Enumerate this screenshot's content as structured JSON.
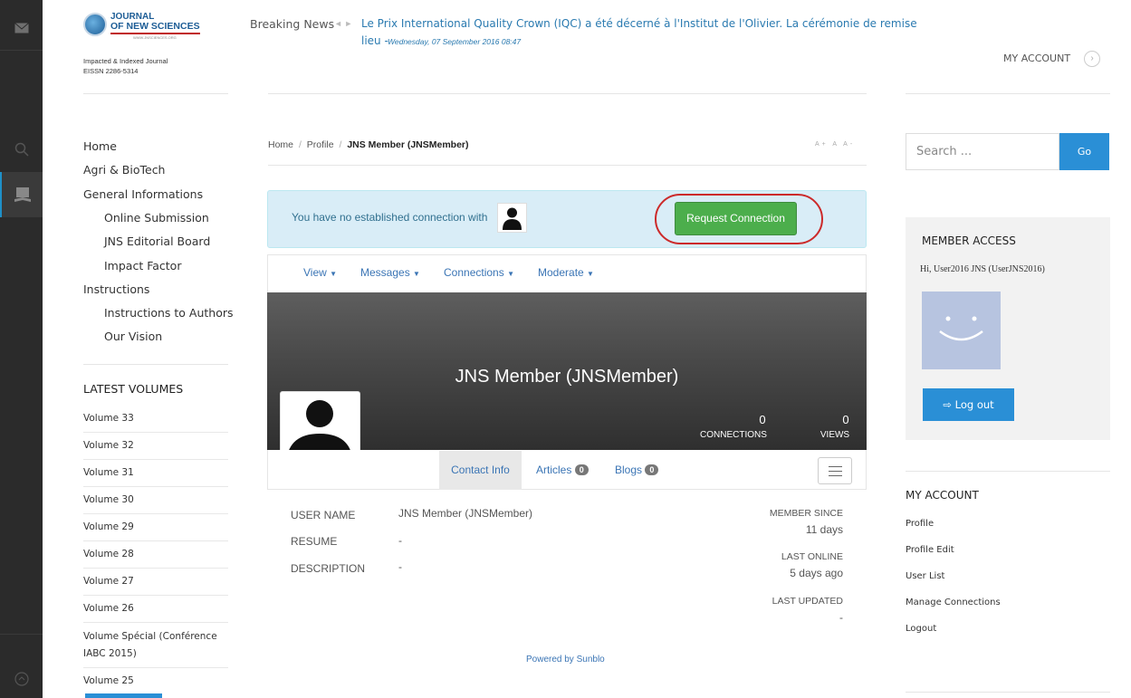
{
  "rail": {
    "icons": [
      "mail-icon",
      "search-icon",
      "book-reader-icon",
      "arrow-circle-icon"
    ]
  },
  "logo": {
    "line1": "JOURNAL",
    "line2": "OF NEW SCIENCES",
    "line3": "WWW.JNSCIENCES.ORG",
    "sub1": "Impacted & Indexed Journal",
    "sub2": "EISSN 2286-5314"
  },
  "news": {
    "label": "Breaking News",
    "text": "Le Prix International Quality Crown (IQC) a été décerné à l'Institut de l'Olivier. La cérémonie de remise",
    "text2": "lieu -",
    "date": "Wednesday, 07 September 2016 08:47"
  },
  "header": {
    "my_account": "MY ACCOUNT"
  },
  "menu": {
    "items": [
      {
        "label": "Home"
      },
      {
        "label": "Agri & BioTech"
      },
      {
        "label": "General Informations"
      },
      {
        "label": "Online Submission"
      },
      {
        "label": "JNS Editorial Board"
      },
      {
        "label": "Impact Factor"
      },
      {
        "label": "Instructions"
      },
      {
        "label": "Instructions to Authors"
      },
      {
        "label": "Our Vision"
      }
    ]
  },
  "latest": {
    "title": "LATEST VOLUMES",
    "volumes": [
      "Volume 33",
      "Volume 32",
      "Volume 31",
      "Volume 30",
      "Volume 29",
      "Volume 28",
      "Volume 27",
      "Volume 26",
      "Volume Spécial (Conférence",
      "IABC 2015)",
      "Volume 25"
    ]
  },
  "breadcrumb": {
    "home": "Home",
    "sep": "/",
    "profile": "Profile",
    "current": "JNS Member (JNSMember)",
    "font_controls": "A+ A A-"
  },
  "alert": {
    "text": "You have no established connection with",
    "button": "Request Connection"
  },
  "profile_nav": {
    "items": [
      "View",
      "Messages",
      "Connections",
      "Moderate"
    ]
  },
  "cover": {
    "name": "JNS Member (JNSMember)",
    "connections_count": "0",
    "connections_label": "CONNECTIONS",
    "views_count": "0",
    "views_label": "VIEWS"
  },
  "tabs": {
    "contact": "Contact Info",
    "articles": "Articles",
    "articles_count": "0",
    "blogs": "Blogs",
    "blogs_count": "0"
  },
  "info": {
    "username_label": "USER NAME",
    "username_value": "JNS Member (JNSMember)",
    "resume_label": "RESUME",
    "resume_value": "-",
    "description_label": "DESCRIPTION",
    "description_value": "-",
    "member_since_label": "MEMBER SINCE",
    "member_since_value": "11 days",
    "last_online_label": "LAST ONLINE",
    "last_online_value": "5 days ago",
    "last_updated_label": "LAST UPDATED",
    "last_updated_value": "-"
  },
  "footer": {
    "powered": "Powered by Sunblo"
  },
  "search": {
    "placeholder": "Search ...",
    "button": "Go"
  },
  "member_access": {
    "title": "MEMBER ACCESS",
    "greeting": "Hi, User2016 JNS (UserJNS2016)",
    "logout": "Log out"
  },
  "my_account": {
    "title": "MY ACCOUNT",
    "links": [
      "Profile",
      "Profile Edit",
      "User List",
      "Manage Connections",
      "Logout"
    ]
  }
}
